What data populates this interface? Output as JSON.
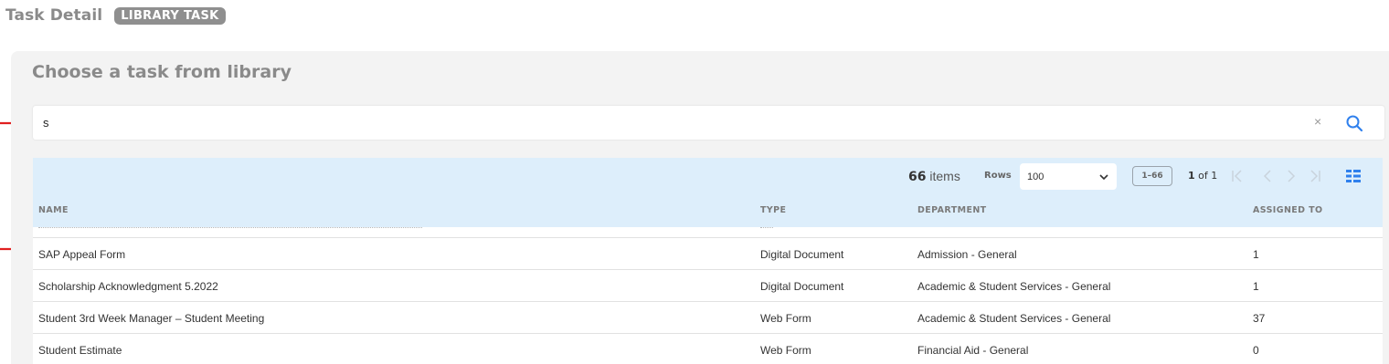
{
  "header": {
    "title": "Task Detail",
    "badge": "LIBRARY TASK"
  },
  "panel": {
    "title": "Choose a task from library"
  },
  "search": {
    "value": "s",
    "clear_glyph": "×"
  },
  "toolbar": {
    "items_count": "66",
    "items_label": "items",
    "rows_label": "Rows",
    "rows_value": "100",
    "range": "1–66",
    "page_current": "1",
    "page_of": "of 1"
  },
  "table": {
    "columns": {
      "name": "NAME",
      "type": "TYPE",
      "department": "DEPARTMENT",
      "assigned_to": "ASSIGNED TO"
    },
    "rows": [
      {
        "name": "SAP Appeal Form",
        "type": "Digital Document",
        "department": "Admission - General",
        "assigned_to": "1"
      },
      {
        "name": "Scholarship Acknowledgment 5.2022",
        "type": "Digital Document",
        "department": "Academic & Student Services - General",
        "assigned_to": "1"
      },
      {
        "name": "Student 3rd Week Manager – Student Meeting",
        "type": "Web Form",
        "department": "Academic & Student Services - General",
        "assigned_to": "37"
      },
      {
        "name": "Student Estimate",
        "type": "Web Form",
        "department": "Financial Aid - General",
        "assigned_to": "0"
      }
    ]
  },
  "colors": {
    "accent": "#2f80ed",
    "annotation_arrow": "#e02020",
    "header_bg": "#ddeefb",
    "panel_bg": "#f3f3f3"
  },
  "icons": [
    "search-icon",
    "close-icon",
    "chevron-down-icon",
    "first-page-icon",
    "prev-page-icon",
    "next-page-icon",
    "last-page-icon",
    "columns-icon",
    "arrow-annotation-icon"
  ]
}
